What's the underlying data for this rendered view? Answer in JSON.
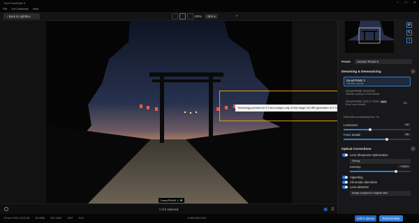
{
  "window": {
    "title": "DxO PureRAW 3",
    "controls": [
      "–",
      "□",
      "✕"
    ]
  },
  "menu": [
    "File",
    "DxO Modules",
    "Help"
  ],
  "toolbar": {
    "back_label": "Back to Lightbox",
    "zoom_value": "100%",
    "zoom_fit": "34%"
  },
  "viewer": {
    "engine_tag": "DeepPRIME 3",
    "tooltip": "Technology preview for X-Trans images only. At this stage, the fifth generation of X-Trans sensors is not yet supported."
  },
  "bottom_bar": {
    "selection": "1 of 2 selected"
  },
  "status": {
    "meta": [
      "19 Nov 2024 19:22:36",
      "35.0MM",
      "ISO 1600",
      "1/20\"",
      "f/2.5"
    ],
    "file_name": "LLM01996.DNG",
    "add_to_queue": "Add to Queue",
    "process_now": "Process Now"
  },
  "panel": {
    "preset_label": "Preset",
    "preset_value": "Custom Preset",
    "denoising_title": "Denoising & Demosaicing",
    "options": [
      {
        "title": "DeepPRIME 3",
        "subtitle": "Ultimate quality",
        "selected": true
      },
      {
        "title": "DeepPRIME XD2s/XD",
        "subtitle": "Ultimate quality & extra details",
        "selected": false
      },
      {
        "title": "DeepPRIME XD3 X-Trans",
        "badge": "BETA",
        "subtitle": "Even more details",
        "selected": false
      }
    ],
    "processing_time": "Estimated processing time: 2s",
    "luminance_label": "Luminance",
    "luminance_value": "40",
    "force_details_label": "Force details",
    "force_details_value": "65",
    "optical_title": "Optical Corrections",
    "lens_sharpness_label": "Lens Sharpness Optimization",
    "lens_sharpness_mode": "Strong",
    "intensity_label": "Intensity",
    "intensity_value": "+150.0",
    "vignetting_label": "Vignetting",
    "chromatic_label": "Chromatic aberration",
    "distortion_label": "Lens distortion",
    "distortion_mode": "Image cropped to original ratio"
  },
  "colors": {
    "accent": "#2f7ed8",
    "highlight": "#e39a1b"
  },
  "icons": [
    "gear-icon",
    "compare-icon",
    "grid-icon",
    "list-icon",
    "help-icon",
    "chat-icon"
  ]
}
